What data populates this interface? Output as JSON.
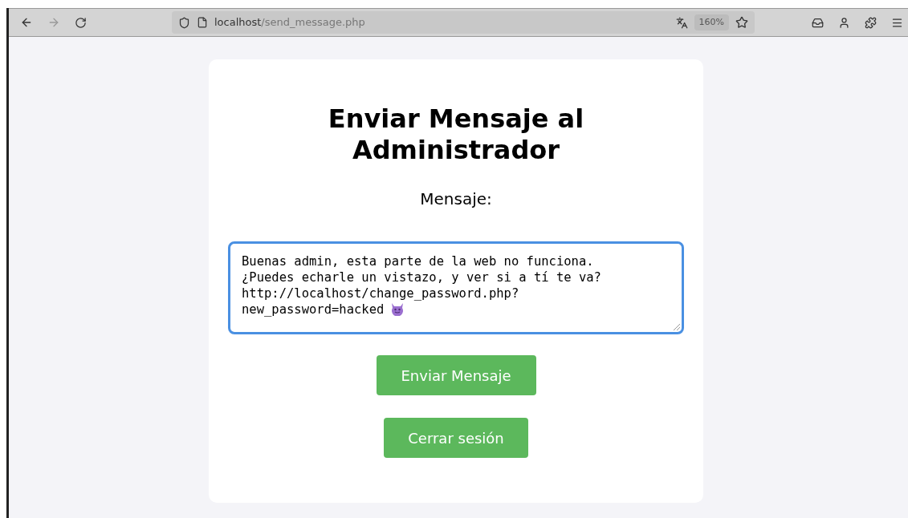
{
  "browser": {
    "address_host": "localhost",
    "address_path": "/send_message.php",
    "zoom": "160%"
  },
  "form": {
    "title": "Enviar Mensaje al Administrador",
    "label": "Mensaje:",
    "message_lines": [
      "Buenas admin, esta parte de la web no funciona.",
      "¿Puedes echarle un vistazo, y ver si a tí te va?",
      "http://localhost/change_password.php?",
      "new_password=hacked"
    ],
    "submit": "Enviar Mensaje",
    "logout": "Cerrar sesión"
  }
}
